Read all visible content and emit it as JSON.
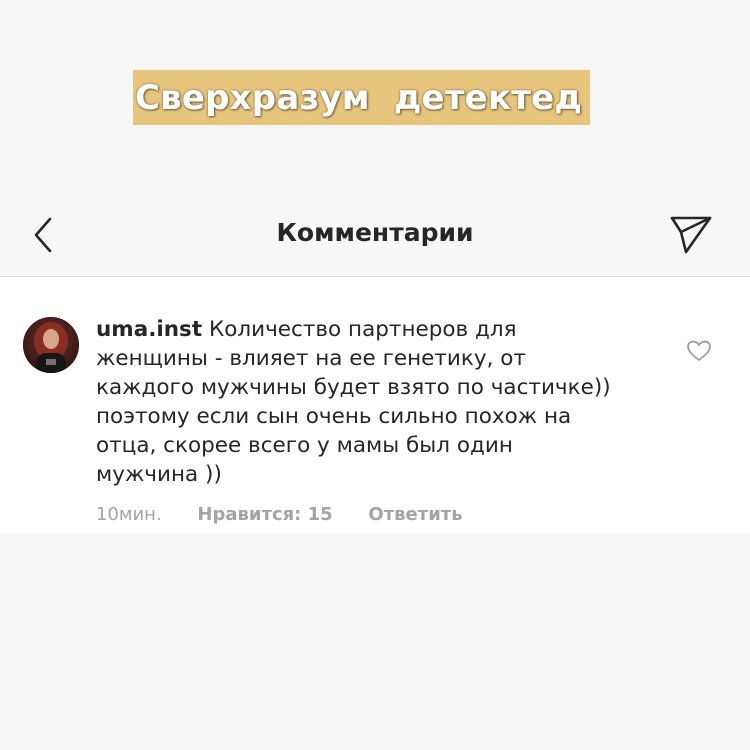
{
  "caption": {
    "text": "Сверхразум  детектед",
    "background": "#e7c57c"
  },
  "header": {
    "title": "Комментарии",
    "back_icon": "chevron-left-icon",
    "share_icon": "paper-plane-icon"
  },
  "comment": {
    "username": "uma.inst",
    "text_lines": [
      " Количество партнеров для",
      "женщины - влияет на ее генетику, от",
      "каждого мужчины будет взято по частичке))",
      "поэтому если сын очень сильно похож на",
      "отца, скорее всего у мамы был один",
      "мужчина ))"
    ],
    "time": "10мин.",
    "likes": "Нравится: 15",
    "reply": "Ответить",
    "like_icon": "heart-outline-icon"
  },
  "colors": {
    "text": "#262626",
    "muted": "#a4a4a4",
    "page_bg": "#f7f7f7",
    "card_bg": "#ffffff"
  }
}
